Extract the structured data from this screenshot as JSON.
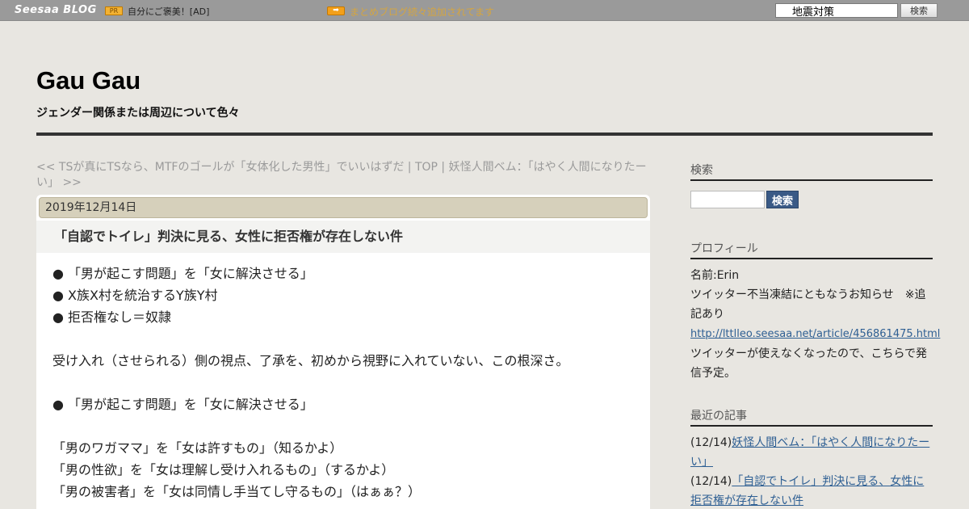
{
  "topbar": {
    "logo": "Seesaa BLOG",
    "pr_badge": "PR",
    "pr_text": "自分にご褒美！[AD]",
    "notice": "まとめブログ続々追加されてます",
    "search_value": "地震対策",
    "search_button": "検索",
    "colors": {
      "bar": "#9a9a9a",
      "badge": "#f3a01a",
      "notice": "#d4a542"
    }
  },
  "header": {
    "title": "Gau Gau",
    "description": "ジェンダー関係または周辺について色々"
  },
  "nav": {
    "prev": "<< TSが真にTSなら、MTFのゴールが「女体化した男性」でいいはずだ",
    "sep1": " | ",
    "top": "TOP",
    "sep2": " | ",
    "next": "妖怪人間ベム：「はやく人間になりたーい」 >>"
  },
  "article": {
    "date": "2019年12月14日",
    "title": "「自認でトイレ」判決に見る、女性に拒否権が存在しない件",
    "lines": [
      "● 「男が起こす問題」を「女に解決させる」",
      "● X族X村を統治するY族Y村",
      "● 拒否権なし＝奴隷",
      "",
      "受け入れ（させられる）側の視点、了承を、初めから視野に入れていない、この根深さ。",
      "",
      "● 「男が起こす問題」を「女に解決させる」",
      "",
      "「男のワガママ」を「女は許すもの」（知るかよ）",
      "「男の性欲」を「女は理解し受け入れるもの」（するかよ）",
      "「男の被害者」を「女は同情し手当てし守るもの」（はぁぁ？）"
    ]
  },
  "sidebar": {
    "search_heading": "検索",
    "search_button": "検索",
    "profile_heading": "プロフィール",
    "profile_name": "名前:Erin",
    "profile_notice": "ツイッター不当凍結にともなうお知らせ　※追記あり",
    "profile_link": "http://lttlleo.seesaa.net/article/456861475.html",
    "profile_note": "ツイッターが使えなくなったので、こちらで発信予定。",
    "recent_heading": "最近の記事",
    "recent": [
      {
        "date": "(12/14)",
        "title": "妖怪人間ベム：「はやく人間になりたーい」"
      },
      {
        "date": "(12/14)",
        "title": "「自認でトイレ」判決に見る、女性に拒否権が存在しない件"
      }
    ]
  }
}
